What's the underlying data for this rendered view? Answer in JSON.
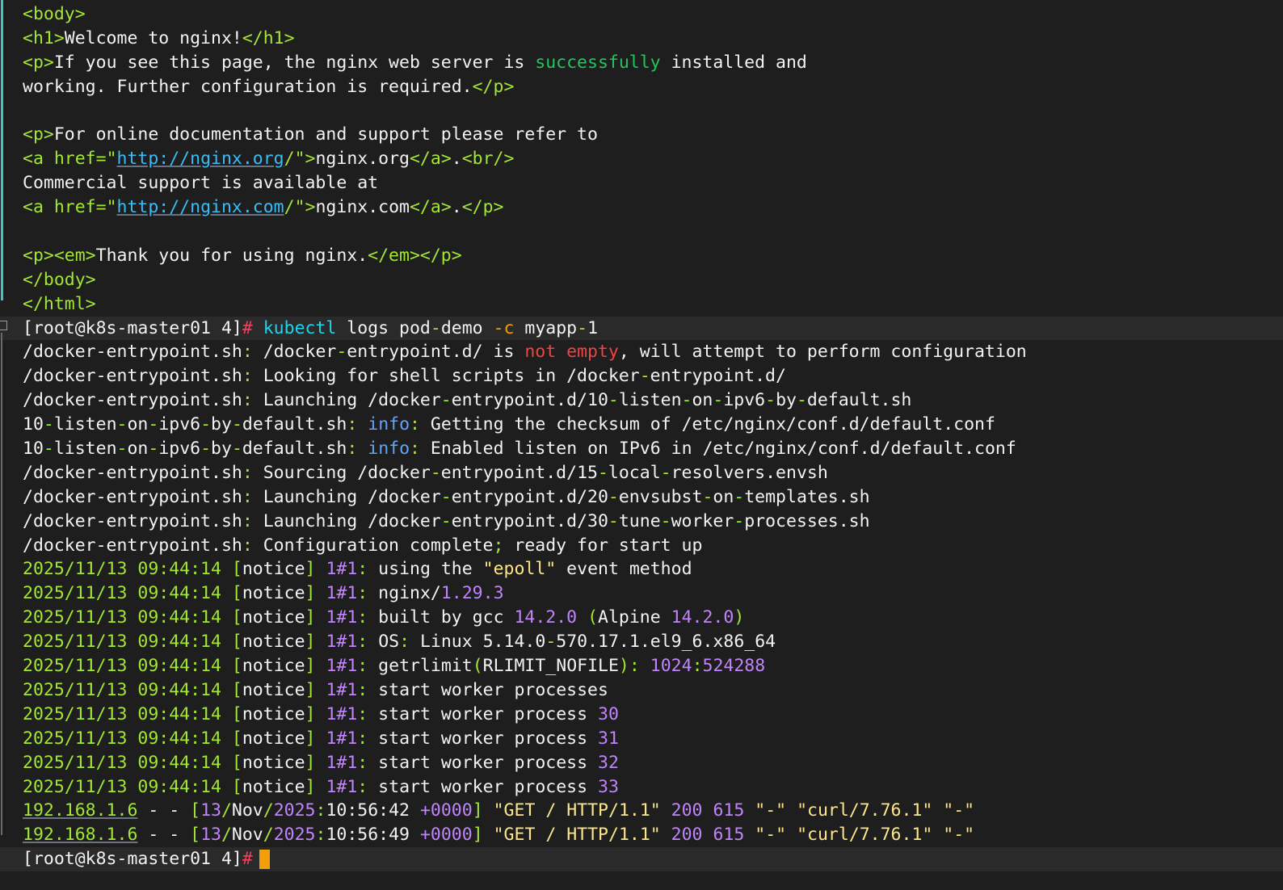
{
  "html_output": {
    "body_open": "<body>",
    "h1_open": "<h1>",
    "h1_text": "Welcome to nginx!",
    "h1_close": "</h1>",
    "p_open": "<p>",
    "p1_text_a": "If you see this page, the nginx web server is ",
    "p1_success": "successfully",
    "p1_text_b": " installed and",
    "p1_text_c": "working. Further configuration is required.",
    "p_close": "</p>",
    "p2_text": "For online documentation and support please refer to",
    "a_open": "<a href=",
    "quote": "\"",
    "org_url": "http://nginx.org",
    "slash": "/",
    "tag_gt": ">",
    "org_text": "nginx.org",
    "a_close": "</a>",
    "dot": ".",
    "br": "<br/>",
    "commercial_text": "Commercial support is available at",
    "com_url": "http://nginx.com",
    "com_text": "nginx.com",
    "em_open": "<em>",
    "thanks_text": "Thank you for using nginx.",
    "em_close": "</em>",
    "body_close": "</body>",
    "html_close": "</html>"
  },
  "prompt": {
    "text": "[root@k8s-master01 4]",
    "symbol": "#"
  },
  "command": {
    "program": "kubectl",
    "args": "logs pod",
    "dash": "-",
    "pod_name_b": "demo",
    "flag": "-c",
    "container_a": "myapp",
    "container_b": "1"
  },
  "log": {
    "entrypoint": "/docker-entrypoint.sh",
    "colon": ":",
    "l1_a": " /docker",
    "l1_b": "entrypoint.d/ is ",
    "l1_not": "not",
    "l1_empty": "empty",
    "l1_c": ", will attempt to perform configuration",
    "l2_a": " Looking for shell scripts in /docker",
    "l2_b": "entrypoint.d/",
    "l3_a": " Launching /docker",
    "l3_b": "entrypoint.d/10",
    "l3_c": "listen",
    "l3_d": "on",
    "l3_e": "ipv6",
    "l3_f": "by",
    "l3_g": "default.sh",
    "ipv6_script_a": "10",
    "info": "info",
    "l4_text": " Getting the checksum of /etc/nginx/conf.d/default.conf",
    "l5_text": " Enabled listen on IPv6 in /etc/nginx/conf.d/default.conf",
    "l6_a": " Sourcing /docker",
    "l6_b": "entrypoint.d/15",
    "l6_c": "local",
    "l6_d": "resolvers.envsh",
    "l7_b": "entrypoint.d/20",
    "l7_c": "envsubst",
    "l7_d": "on",
    "l7_e": "templates.sh",
    "l8_b": "entrypoint.d/30",
    "l8_c": "tune",
    "l8_d": "worker",
    "l8_e": "processes.sh",
    "l9_a": " Configuration complete",
    "l9_semi": ";",
    "l9_b": " ready for start up",
    "timestamp": "2025/11/13 09:44:14",
    "lb": "[",
    "rb": "]",
    "notice": "notice",
    "pid": "1#1",
    "n1_a": " using the ",
    "n1_epoll": "\"epoll\"",
    "n1_b": " event method",
    "n2_a": " nginx/",
    "n2_ver": "1.29.3",
    "n3_a": " built by gcc ",
    "n3_ver": "14.2.0",
    "n3_paren_open": "(",
    "n3_alpine": "Alpine ",
    "n3_paren_close": ")",
    "n4_a": " Linux 5.14.0",
    "n4_os": "OS",
    "n4_b": "570.17.1.el9_6.x86_64",
    "n5_a": " getrlimit",
    "n5_arg": "RLIMIT_NOFILE",
    "n5_v1": "1024",
    "n5_v2": "524288",
    "n6_text": " start worker processes",
    "n7_text": " start worker process ",
    "worker_pids": [
      "30",
      "31",
      "32",
      "33"
    ]
  },
  "access_log": [
    {
      "ip": "192.168.1.6",
      "dashes": " - - ",
      "day": "13",
      "month": "Nov",
      "year": "2025",
      "time": "10:56:42",
      "tz": "+0000",
      "request": "\"GET / HTTP/1.1\"",
      "status": "200",
      "bytes": "615",
      "referer": "\"-\"",
      "agent": "\"curl/7.76.1\""
    },
    {
      "ip": "192.168.1.6",
      "dashes": " - - ",
      "day": "13",
      "month": "Nov",
      "year": "2025",
      "time": "10:56:49",
      "tz": "+0000",
      "request": "\"GET / HTTP/1.1\"",
      "status": "200",
      "bytes": "615",
      "referer": "\"-\"",
      "agent": "\"curl/7.76.1\""
    }
  ],
  "colors": {
    "background": "#1e1e1e",
    "cursor": "#f59e0b",
    "gutter": "#3ec6c6"
  }
}
